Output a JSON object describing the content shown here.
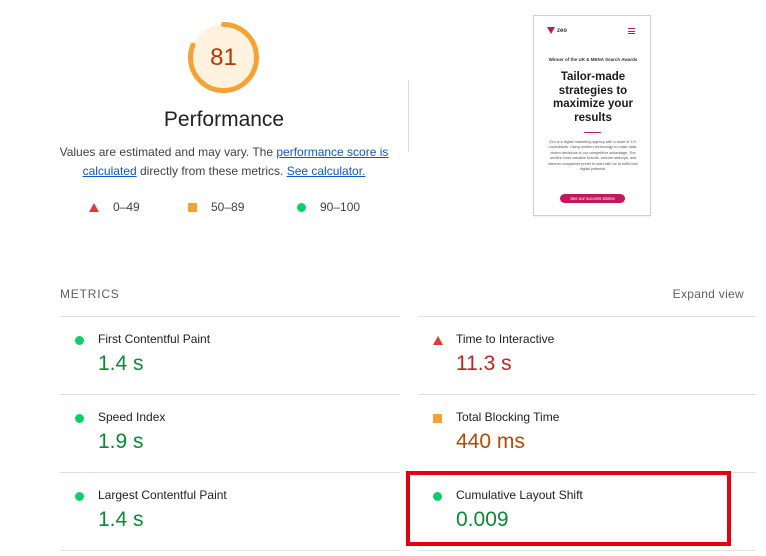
{
  "score": {
    "value": "81",
    "fraction": 0.81,
    "title": "Performance",
    "color": "#f4a234"
  },
  "description": {
    "prefix": "Values are estimated and may vary. The ",
    "link1": "performance score is calculated",
    "middle": " directly from these metrics. ",
    "link2": "See calculator."
  },
  "legend": {
    "poor": "0–49",
    "average": "50–89",
    "good": "90–100"
  },
  "preview": {
    "logo": "zeo",
    "kicker": "Winner of the UK & MENA Search Awards",
    "headline": "Tailor-made strategies to maximize your results",
    "body": "Zeo is a digital marketing agency with a team of 13+ consultants. Using modern technology to make data-driven decisions is our competitive advantage. The world's most valuable brands, unicorn startups, and internet companies prefer to start with us to fulfill their digital potential.",
    "cta": "See our success stories"
  },
  "metrics_header": {
    "label": "METRICS",
    "expand": "Expand view"
  },
  "metrics": [
    {
      "name": "First Contentful Paint",
      "value": "1.4 s",
      "status": "good"
    },
    {
      "name": "Time to Interactive",
      "value": "11.3 s",
      "status": "poor"
    },
    {
      "name": "Speed Index",
      "value": "1.9 s",
      "status": "good"
    },
    {
      "name": "Total Blocking Time",
      "value": "440 ms",
      "status": "average"
    },
    {
      "name": "Largest Contentful Paint",
      "value": "1.4 s",
      "status": "good"
    },
    {
      "name": "Cumulative Layout Shift",
      "value": "0.009",
      "status": "good"
    }
  ],
  "colors": {
    "good": "#0cce6b",
    "average": "#f4a234",
    "poor": "#e53935",
    "highlight": "#e3000f"
  }
}
